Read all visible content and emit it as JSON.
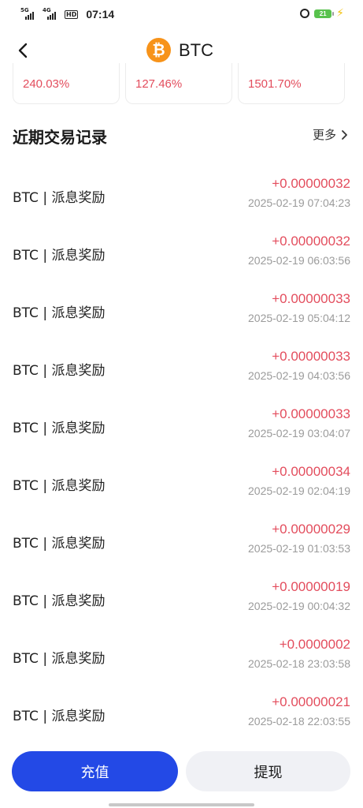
{
  "status_bar": {
    "net1": "5G",
    "net2": "4G",
    "hd": "HD",
    "time": "07:14",
    "battery": "21"
  },
  "header": {
    "coin_symbol": "₿",
    "title": "BTC"
  },
  "stats": [
    "240.03%",
    "127.46%",
    "1501.70%"
  ],
  "section": {
    "title": "近期交易记录",
    "more": "更多"
  },
  "records": [
    {
      "label": "BTC | 派息奖励",
      "amount": "+0.00000032",
      "time": "2025-02-19 07:04:23"
    },
    {
      "label": "BTC | 派息奖励",
      "amount": "+0.00000032",
      "time": "2025-02-19 06:03:56"
    },
    {
      "label": "BTC | 派息奖励",
      "amount": "+0.00000033",
      "time": "2025-02-19 05:04:12"
    },
    {
      "label": "BTC | 派息奖励",
      "amount": "+0.00000033",
      "time": "2025-02-19 04:03:56"
    },
    {
      "label": "BTC | 派息奖励",
      "amount": "+0.00000033",
      "time": "2025-02-19 03:04:07"
    },
    {
      "label": "BTC | 派息奖励",
      "amount": "+0.00000034",
      "time": "2025-02-19 02:04:19"
    },
    {
      "label": "BTC | 派息奖励",
      "amount": "+0.00000029",
      "time": "2025-02-19 01:03:53"
    },
    {
      "label": "BTC | 派息奖励",
      "amount": "+0.00000019",
      "time": "2025-02-19 00:04:32"
    },
    {
      "label": "BTC | 派息奖励",
      "amount": "+0.0000002",
      "time": "2025-02-18 23:03:58"
    },
    {
      "label": "BTC | 派息奖励",
      "amount": "+0.00000021",
      "time": "2025-02-18 22:03:55"
    }
  ],
  "actions": {
    "deposit": "充值",
    "withdraw": "提现"
  },
  "colors": {
    "accent": "#2349e6",
    "positive": "#e34d5d",
    "muted": "#9b9b9b",
    "bitcoin": "#f7931a"
  }
}
